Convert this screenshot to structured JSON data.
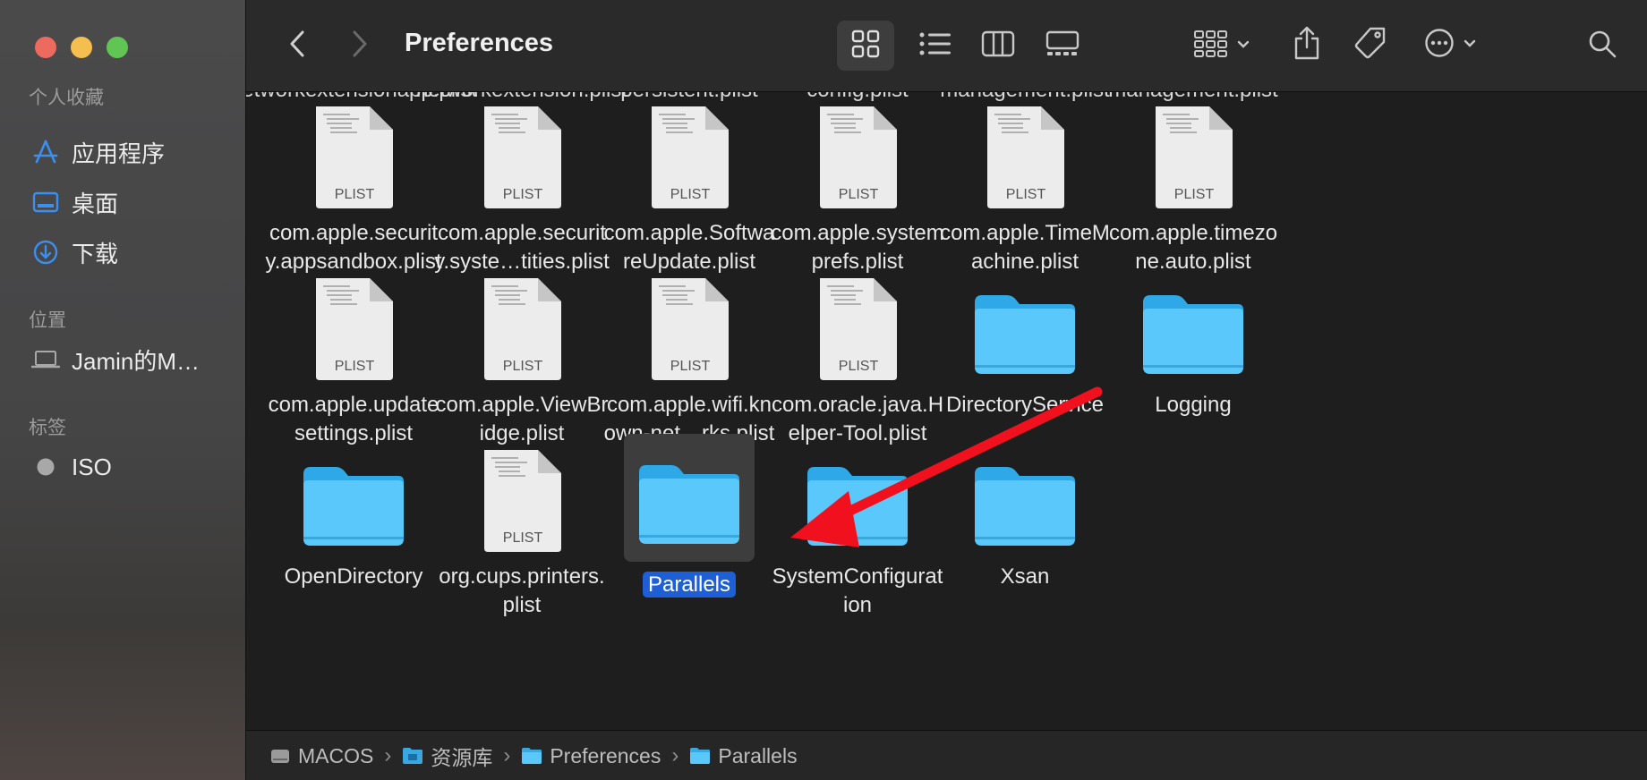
{
  "window": {
    "title": "Preferences"
  },
  "sidebar": {
    "favorites_header": "个人收藏",
    "favorites": [
      {
        "label": "应用程序",
        "icon": "applications-icon"
      },
      {
        "label": "桌面",
        "icon": "desktop-icon"
      },
      {
        "label": "下载",
        "icon": "downloads-icon"
      }
    ],
    "locations_header": "位置",
    "locations": [
      {
        "label": "Jamin的M…",
        "icon": "laptop-icon"
      }
    ],
    "tags_header": "标签",
    "tags": [
      {
        "label": "ISO",
        "icon": "tag-dot-icon",
        "color": "#a8a8a8"
      }
    ]
  },
  "toolbar": {
    "back": "chevron-left-icon",
    "forward": "chevron-right-icon",
    "views": [
      "icon-view-icon",
      "list-view-icon",
      "column-view-icon",
      "gallery-view-icon"
    ],
    "active_view": "icon-view-icon",
    "actions": [
      "group-icon",
      "share-icon",
      "tag-icon",
      "more-icon",
      "search-icon"
    ]
  },
  "content": {
    "cut_row": [
      "networkextensionapp.plist",
      "networkextension.plist",
      "persistent.plist",
      "config.plist",
      "management.plist",
      "management.plist"
    ],
    "items": [
      {
        "name1": "com.apple.securit",
        "name2": "y.appsandbox.plist",
        "type": "plist",
        "badge": "PLIST"
      },
      {
        "name1": "com.apple.securit",
        "name2": "y.syste…tities.plist",
        "type": "plist",
        "badge": "PLIST"
      },
      {
        "name1": "com.apple.Softwa",
        "name2": "reUpdate.plist",
        "type": "plist",
        "badge": "PLIST"
      },
      {
        "name1": "com.apple.system",
        "name2": "prefs.plist",
        "type": "plist",
        "badge": "PLIST"
      },
      {
        "name1": "com.apple.TimeM",
        "name2": "achine.plist",
        "type": "plist",
        "badge": "PLIST"
      },
      {
        "name1": "com.apple.timezo",
        "name2": "ne.auto.plist",
        "type": "plist",
        "badge": "PLIST"
      },
      {
        "name1": "com.apple.update",
        "name2": "settings.plist",
        "type": "plist",
        "badge": "PLIST"
      },
      {
        "name1": "com.apple.ViewBr",
        "name2": "idge.plist",
        "type": "plist",
        "badge": "PLIST"
      },
      {
        "name1": "com.apple.wifi.kn",
        "name2": "own-net…rks.plist",
        "type": "plist",
        "badge": "PLIST"
      },
      {
        "name1": "com.oracle.java.H",
        "name2": "elper-Tool.plist",
        "type": "plist",
        "badge": "PLIST"
      },
      {
        "name1": "DirectoryService",
        "name2": "",
        "type": "folder"
      },
      {
        "name1": "Logging",
        "name2": "",
        "type": "folder"
      },
      {
        "name1": "OpenDirectory",
        "name2": "",
        "type": "folder"
      },
      {
        "name1": "org.cups.printers.",
        "name2": "plist",
        "type": "plist",
        "badge": "PLIST"
      },
      {
        "name1": "Parallels",
        "name2": "",
        "type": "folder",
        "selected": true
      },
      {
        "name1": "SystemConfigurat",
        "name2": "ion",
        "type": "folder"
      },
      {
        "name1": "Xsan",
        "name2": "",
        "type": "folder"
      }
    ]
  },
  "pathbar": {
    "crumbs": [
      {
        "label": "MACOS",
        "icon": "disk-icon"
      },
      {
        "label": "资源库",
        "icon": "library-folder-icon"
      },
      {
        "label": "Preferences",
        "icon": "folder-icon"
      },
      {
        "label": "Parallels",
        "icon": "folder-icon"
      }
    ],
    "separator": "›"
  },
  "annotation": {
    "type": "arrow",
    "color": "#f0101e"
  },
  "colors": {
    "folder": "#5ac8fa",
    "selection": "#1f5fd6",
    "accent": "#3a8ff0"
  }
}
